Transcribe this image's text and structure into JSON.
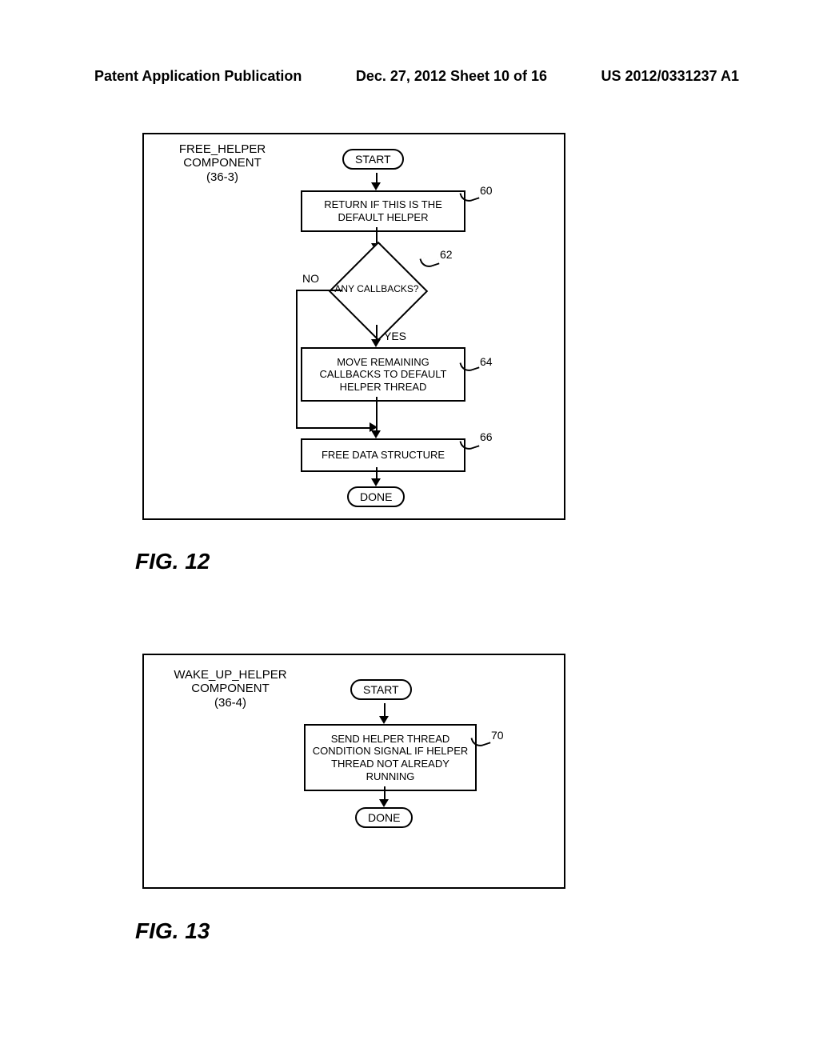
{
  "header": {
    "left": "Patent Application Publication",
    "center": "Dec. 27, 2012  Sheet 10 of 16",
    "right": "US 2012/0331237 A1"
  },
  "fig12": {
    "panel_title_l1": "FREE_HELPER",
    "panel_title_l2": "COMPONENT",
    "panel_title_l3": "(36-3)",
    "start": "START",
    "step60": "RETURN IF THIS IS THE DEFAULT HELPER",
    "ref60": "60",
    "dec62": "ANY CALLBACKS?",
    "ref62": "62",
    "dec_no": "NO",
    "dec_yes": "YES",
    "step64": "MOVE REMAINING CALLBACKS TO DEFAULT HELPER THREAD",
    "ref64": "64",
    "step66": "FREE DATA STRUCTURE",
    "ref66": "66",
    "done": "DONE",
    "caption": "FIG. 12"
  },
  "fig13": {
    "panel_title_l1": "WAKE_UP_HELPER",
    "panel_title_l2": "COMPONENT",
    "panel_title_l3": "(36-4)",
    "start": "START",
    "step70": "SEND HELPER THREAD CONDITION SIGNAL IF HELPER THREAD NOT ALREADY RUNNING",
    "ref70": "70",
    "done": "DONE",
    "caption": "FIG. 13"
  },
  "chart_data": [
    {
      "type": "diagram",
      "figure": "FIG. 12",
      "title": "FREE_HELPER COMPONENT (36-3)",
      "nodes": [
        {
          "id": "start",
          "kind": "terminator",
          "text": "START"
        },
        {
          "id": "60",
          "kind": "process",
          "text": "RETURN IF THIS IS THE DEFAULT HELPER"
        },
        {
          "id": "62",
          "kind": "decision",
          "text": "ANY CALLBACKS?"
        },
        {
          "id": "64",
          "kind": "process",
          "text": "MOVE REMAINING CALLBACKS TO DEFAULT HELPER THREAD"
        },
        {
          "id": "66",
          "kind": "process",
          "text": "FREE DATA STRUCTURE"
        },
        {
          "id": "done",
          "kind": "terminator",
          "text": "DONE"
        }
      ],
      "edges": [
        {
          "from": "start",
          "to": "60"
        },
        {
          "from": "60",
          "to": "62"
        },
        {
          "from": "62",
          "to": "64",
          "label": "YES"
        },
        {
          "from": "62",
          "to": "66",
          "label": "NO"
        },
        {
          "from": "64",
          "to": "66"
        },
        {
          "from": "66",
          "to": "done"
        }
      ]
    },
    {
      "type": "diagram",
      "figure": "FIG. 13",
      "title": "WAKE_UP_HELPER COMPONENT (36-4)",
      "nodes": [
        {
          "id": "start",
          "kind": "terminator",
          "text": "START"
        },
        {
          "id": "70",
          "kind": "process",
          "text": "SEND HELPER THREAD CONDITION SIGNAL IF HELPER THREAD NOT ALREADY RUNNING"
        },
        {
          "id": "done",
          "kind": "terminator",
          "text": "DONE"
        }
      ],
      "edges": [
        {
          "from": "start",
          "to": "70"
        },
        {
          "from": "70",
          "to": "done"
        }
      ]
    }
  ]
}
